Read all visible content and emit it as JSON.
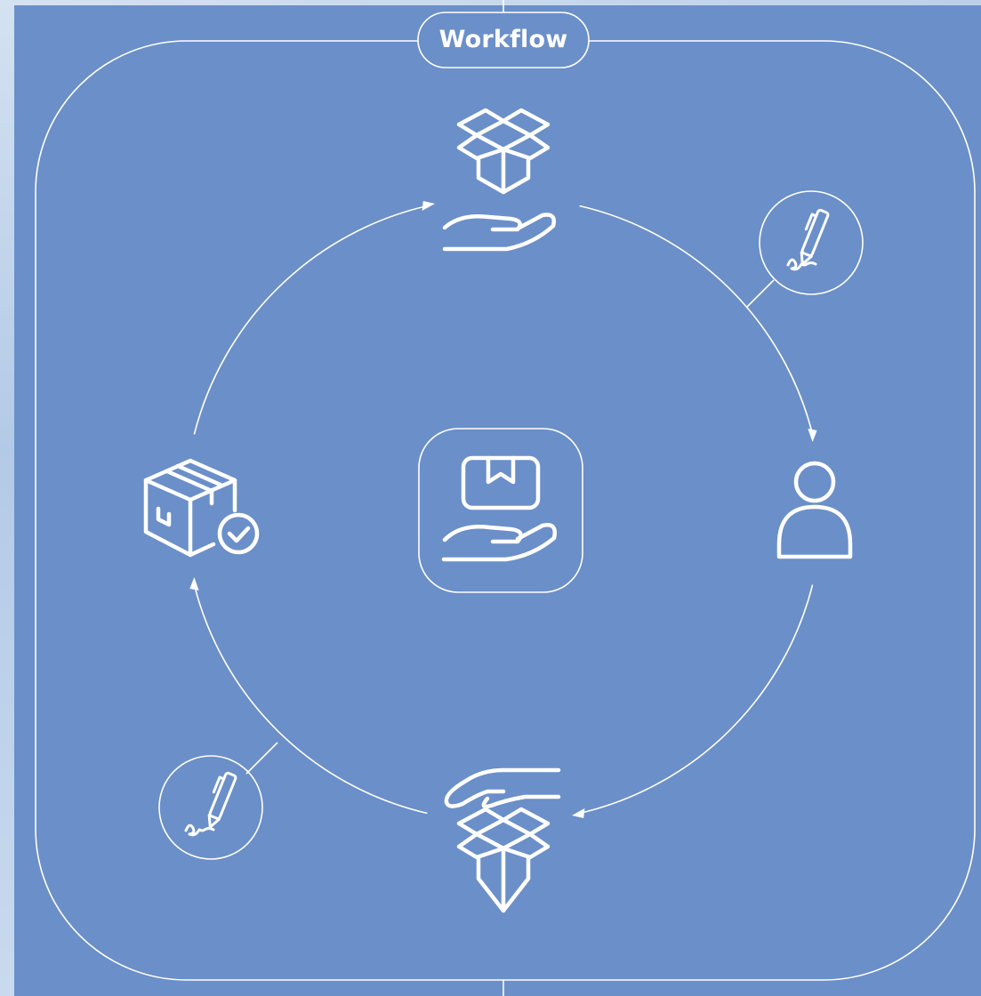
{
  "diagram": {
    "title": "Workflow",
    "colors": {
      "background": "#6b8fc8",
      "line": "#ffffff"
    },
    "center_node": {
      "icon": "package-in-hand-icon"
    },
    "cycle_nodes": [
      {
        "position": "top",
        "icon": "open-box-on-hand-icon"
      },
      {
        "position": "right",
        "icon": "user-icon"
      },
      {
        "position": "bottom",
        "icon": "handshake-box-icon"
      },
      {
        "position": "left",
        "icon": "package-check-icon"
      }
    ],
    "side_badges": [
      {
        "attached_to": "top-right-arc",
        "icon": "pen-signature-icon"
      },
      {
        "attached_to": "bottom-left-arc",
        "icon": "pen-signature-icon"
      }
    ],
    "flow_direction": "clockwise"
  }
}
